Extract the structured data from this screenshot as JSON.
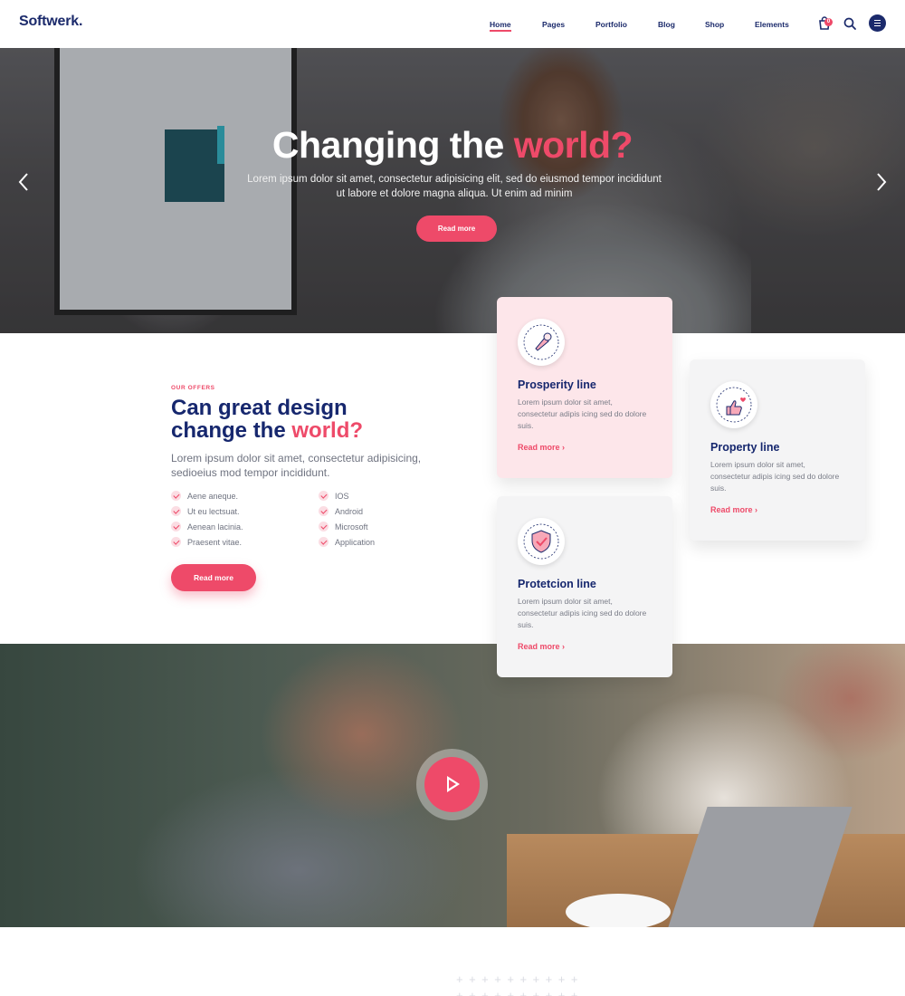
{
  "header": {
    "logo": "Softwerk.",
    "nav": [
      {
        "label": "Home",
        "active": true
      },
      {
        "label": "Pages"
      },
      {
        "label": "Portfolio"
      },
      {
        "label": "Blog"
      },
      {
        "label": "Shop"
      },
      {
        "label": "Elements"
      }
    ],
    "cart_count": "0",
    "icons": [
      "shopping-bag-icon",
      "search-icon",
      "hamburger-menu-icon"
    ]
  },
  "hero": {
    "title_main": "Changing the",
    "title_accent": "world?",
    "subtitle": "Lorem ipsum dolor sit amet, consectetur adipisicing elit, sed do eiusmod tempor incididunt ut labore et dolore magna aliqua. Ut enim ad minim",
    "button": "Read more"
  },
  "offers": {
    "eyebrow": "OUR OFFERS",
    "title_line1": "Can great design",
    "title_line2": "change the",
    "title_accent": "world?",
    "description": "Lorem ipsum dolor sit amet, consectetur adipisicing, sedioeius mod tempor incididunt.",
    "list_left": [
      "Aene aneque.",
      "Ut eu lectsuat.",
      "Aenean lacinia.",
      "Praesent vitae."
    ],
    "list_right": [
      "IOS",
      "Android",
      "Microsoft",
      "Application"
    ],
    "button": "Read more"
  },
  "cards": [
    {
      "title": "Prosperity line",
      "text": "Lorem ipsum dolor sit amet, consectetur adipis icing sed do dolore suis.",
      "link": "Read more ›",
      "icon": "ice-cream-icon"
    },
    {
      "title": "Property line",
      "text": "Lorem ipsum dolor sit amet, consectetur adipis icing sed do dolore suis.",
      "link": "Read more ›",
      "icon": "thumbs-up-heart-icon"
    },
    {
      "title": "Protetcion line",
      "text": "Lorem ipsum dolor sit amet, consectetur adipis icing sed do dolore suis.",
      "link": "Read more ›",
      "icon": "shield-check-icon"
    }
  ],
  "colors": {
    "accent": "#ee4a69",
    "navy": "#16276e",
    "card_pink": "#fde6ea",
    "card_gray": "#f4f4f5"
  }
}
